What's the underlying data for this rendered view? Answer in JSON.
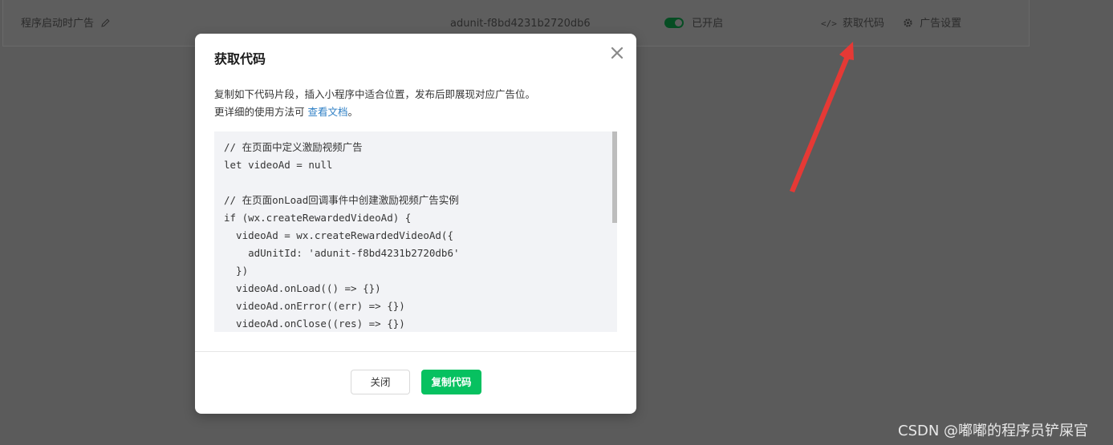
{
  "row": {
    "ad_name": "程序启动时广告",
    "ad_unit_id": "adunit-f8bd4231b2720db6",
    "status_text": "已开启",
    "get_code_label": "获取代码",
    "code_icon_glyph": "</>",
    "ad_settings_label": "广告设置"
  },
  "modal": {
    "title": "获取代码",
    "description_line1": "复制如下代码片段，插入小程序中适合位置，发布后即展现对应广告位。",
    "description_line2_prefix": "更详细的使用方法可 ",
    "doc_link": "查看文档",
    "description_line2_suffix": "。",
    "code": "// 在页面中定义激励视频广告\nlet videoAd = null\n\n// 在页面onLoad回调事件中创建激励视频广告实例\nif (wx.createRewardedVideoAd) {\n  videoAd = wx.createRewardedVideoAd({\n    adUnitId: 'adunit-f8bd4231b2720db6'\n  })\n  videoAd.onLoad(() => {})\n  videoAd.onError((err) => {})\n  videoAd.onClose((res) => {})",
    "close_button": "关闭",
    "copy_button": "复制代码"
  },
  "watermark": "CSDN @嘟嘟的程序员铲屎官",
  "colors": {
    "accent_green": "#07c160",
    "link_blue": "#2e7fc5",
    "arrow_red": "#e53935"
  },
  "icons": [
    "edit-icon",
    "toggle-switch",
    "code-icon",
    "gear-icon",
    "close-icon",
    "annotation-arrow"
  ]
}
